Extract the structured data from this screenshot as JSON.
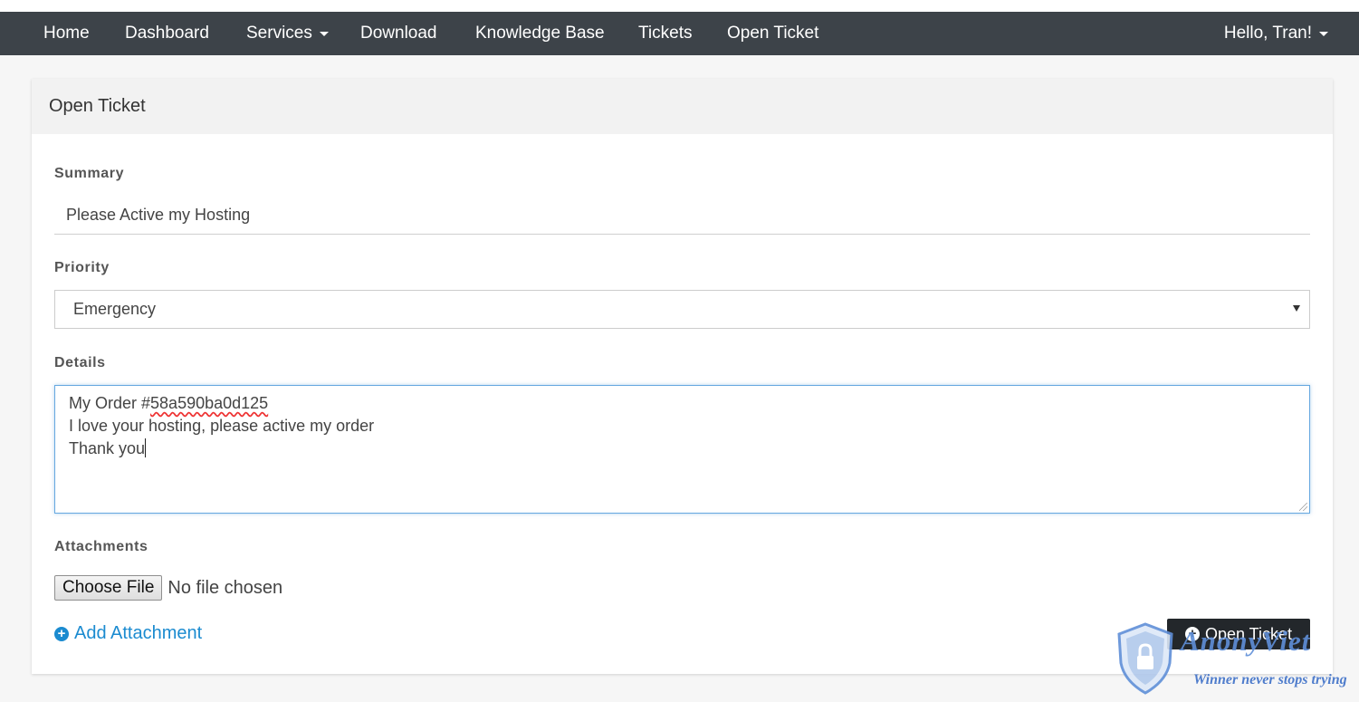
{
  "navbar": {
    "items": [
      {
        "label": "Home"
      },
      {
        "label": "Dashboard"
      },
      {
        "label": "Services",
        "has_dropdown": true
      },
      {
        "label": "Download"
      },
      {
        "label": "Knowledge Base"
      },
      {
        "label": "Tickets"
      },
      {
        "label": "Open Ticket"
      }
    ],
    "user_menu_label": "Hello, Tran!",
    "background_color": "#3d4349"
  },
  "panel": {
    "title": "Open Ticket"
  },
  "form": {
    "summary": {
      "label": "Summary",
      "value": "Please Active my Hosting"
    },
    "priority": {
      "label": "Priority",
      "selected": "Emergency"
    },
    "details": {
      "label": "Details",
      "lines": [
        "My Order #58a590ba0d125",
        "I love your hosting, please active my order",
        "Thank you"
      ],
      "line1_prefix": "My Order #",
      "line1_misspelled": "58a590ba0d125"
    },
    "attachments": {
      "label": "Attachments",
      "choose_file_label": "Choose File",
      "file_status": "No file chosen",
      "add_attachment_label": "Add Attachment"
    },
    "submit_label": "Open Ticket"
  },
  "watermark": {
    "brand": "AnonyViet",
    "slogan": "Winner never stops trying"
  },
  "colors": {
    "accent": "#1b8bd0",
    "focus_border": "#66a8e0",
    "submit_bg": "#23272b"
  }
}
